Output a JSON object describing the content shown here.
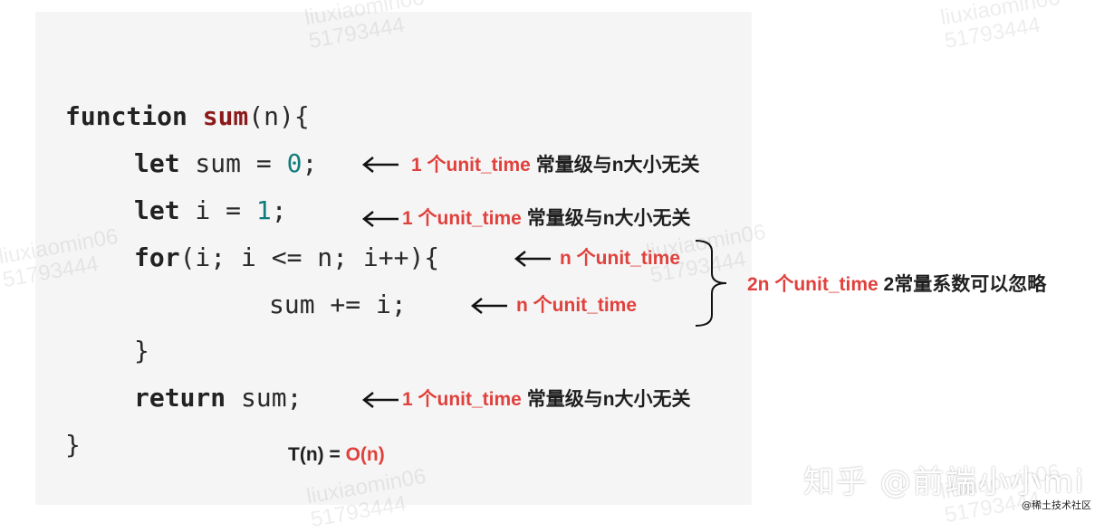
{
  "code": {
    "line1": {
      "keyword": "function",
      "name": "sum",
      "rest": "(n){"
    },
    "line2": {
      "keyword": "let",
      "text": " sum = ",
      "number": "0",
      "end": ";"
    },
    "line3": {
      "keyword": "let",
      "text": " i = ",
      "number": "1",
      "end": ";"
    },
    "line4": {
      "keyword": "for",
      "rest": "(i; i <= n; i++){"
    },
    "line5": {
      "text": "sum += i;"
    },
    "line6": {
      "text": "}"
    },
    "line7": {
      "keyword": "return",
      "rest": " sum;"
    },
    "line8": {
      "text": "}"
    }
  },
  "annotations": {
    "a1": {
      "red": "1 个unit_time",
      "dark": " 常量级与n大小无关"
    },
    "a2": {
      "red": "1 个unit_time",
      "dark": " 常量级与n大小无关"
    },
    "a3": {
      "red": "n 个unit_time"
    },
    "a4": {
      "red": "n 个unit_time"
    },
    "a5": {
      "red": "1 个unit_time",
      "dark": " 常量级与n大小无关"
    },
    "brace_note": {
      "red": "2n 个unit_time",
      "dark": " 2常量系数可以忽略"
    }
  },
  "complexity": {
    "prefix": "T(n) = ",
    "value": "O(n)"
  },
  "watermark": {
    "text": "liuxiaomin06\n51793444"
  },
  "footer": {
    "zhihu": "知乎 @前端小小mi",
    "juejin": "@稀土技术社区"
  },
  "colors": {
    "accent_red": "#e0413c",
    "function_name": "#8b1a1a",
    "number": "#127c7c",
    "panel_bg": "#f5f5f5"
  },
  "icons": {
    "arrow": "left-arrow-icon",
    "brace": "right-curly-brace-icon"
  }
}
